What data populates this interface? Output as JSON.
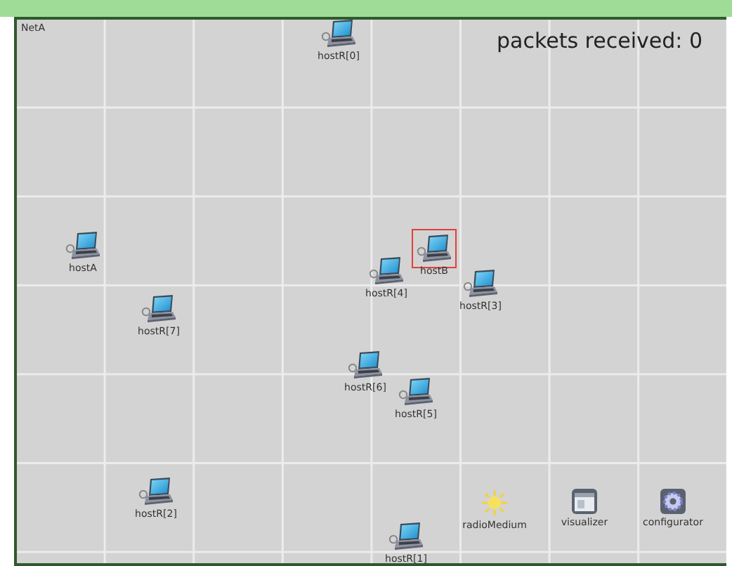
{
  "network": {
    "name": "NetA",
    "status": "packets received: 0",
    "nodes": [
      {
        "label": "hostR[0]",
        "kind": "host",
        "selected": false
      },
      {
        "label": "hostA",
        "kind": "host",
        "selected": false
      },
      {
        "label": "hostB",
        "kind": "host",
        "selected": true
      },
      {
        "label": "hostR[4]",
        "kind": "host",
        "selected": false
      },
      {
        "label": "hostR[3]",
        "kind": "host",
        "selected": false
      },
      {
        "label": "hostR[7]",
        "kind": "host",
        "selected": false
      },
      {
        "label": "hostR[6]",
        "kind": "host",
        "selected": false
      },
      {
        "label": "hostR[5]",
        "kind": "host",
        "selected": false
      },
      {
        "label": "hostR[2]",
        "kind": "host",
        "selected": false
      },
      {
        "label": "radioMedium",
        "kind": "medium",
        "selected": false
      },
      {
        "label": "visualizer",
        "kind": "visualizer",
        "selected": false
      },
      {
        "label": "configurator",
        "kind": "configurator",
        "selected": false
      },
      {
        "label": "hostR[1]",
        "kind": "host",
        "selected": false
      }
    ]
  }
}
